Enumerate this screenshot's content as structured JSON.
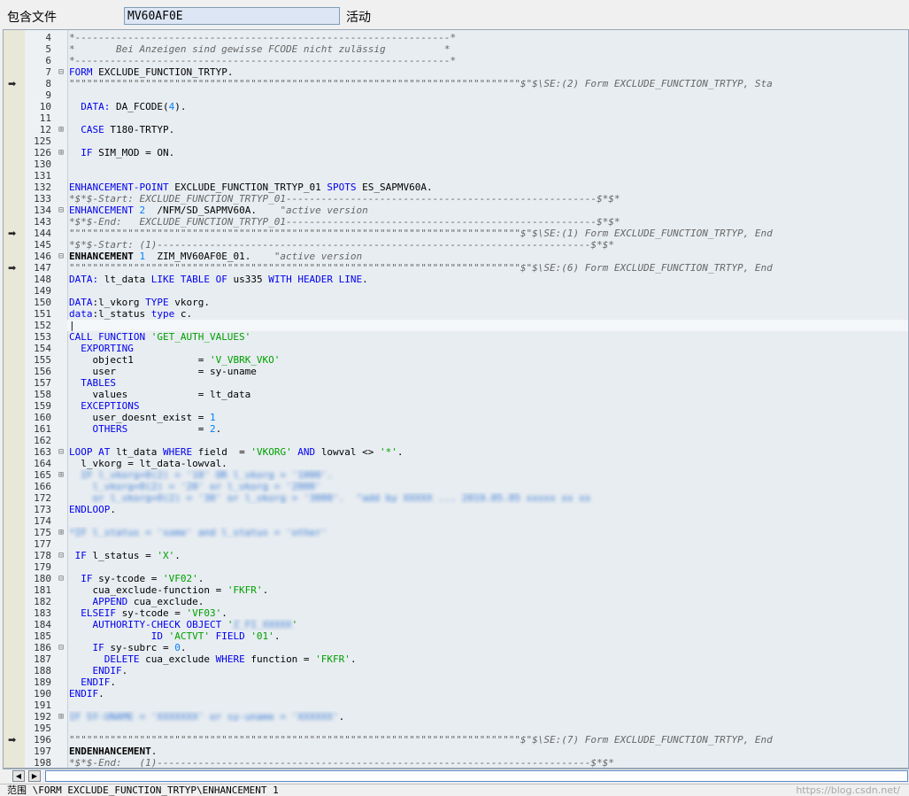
{
  "header": {
    "include_label": "包含文件",
    "program_name": "MV60AF0E",
    "status": "活动"
  },
  "editor": {
    "lines": [
      {
        "n": "4",
        "fold": "",
        "arrow": false,
        "segs": [
          [
            "cmt",
            "*----------------------------------------------------------------*"
          ]
        ]
      },
      {
        "n": "5",
        "fold": "",
        "arrow": false,
        "segs": [
          [
            "cmt",
            "*       Bei Anzeigen sind gewisse FCODE nicht zulässig          *"
          ]
        ]
      },
      {
        "n": "6",
        "fold": "",
        "arrow": false,
        "segs": [
          [
            "cmt",
            "*----------------------------------------------------------------*"
          ]
        ]
      },
      {
        "n": "7",
        "fold": "⊟",
        "arrow": false,
        "segs": [
          [
            "kw",
            "FORM "
          ],
          [
            "plain",
            "EXCLUDE_FUNCTION_TRTYP."
          ]
        ]
      },
      {
        "n": "8",
        "fold": "",
        "arrow": true,
        "segs": [
          [
            "cmt",
            "\"\"\"\"\"\"\"\"\"\"\"\"\"\"\"\"\"\"\"\"\"\"\"\"\"\"\"\"\"\"\"\"\"\"\"\"\"\"\"\"\"\"\"\"\"\"\"\"\"\"\"\"\"\"\"\"\"\"\"\"\"\"\"\"\"\"\"\"\"\"\"\"\"\"\"\"\"$\"$\\SE:(2) Form EXCLUDE_FUNCTION_TRTYP, Sta"
          ]
        ]
      },
      {
        "n": "9",
        "fold": "",
        "arrow": false,
        "segs": []
      },
      {
        "n": "10",
        "fold": "",
        "arrow": false,
        "segs": [
          [
            "kw",
            "  DATA: "
          ],
          [
            "plain",
            "DA_FCODE("
          ],
          [
            "num",
            "4"
          ],
          [
            "plain",
            ")."
          ]
        ]
      },
      {
        "n": "11",
        "fold": "",
        "arrow": false,
        "segs": []
      },
      {
        "n": "12",
        "fold": "⊞",
        "arrow": false,
        "segs": [
          [
            "kw",
            "  CASE "
          ],
          [
            "plain",
            "T180-TRTYP."
          ]
        ]
      },
      {
        "n": "125",
        "fold": "",
        "arrow": false,
        "segs": []
      },
      {
        "n": "126",
        "fold": "⊞",
        "arrow": false,
        "segs": [
          [
            "kw",
            "  IF "
          ],
          [
            "plain",
            "SIM_MOD = ON."
          ]
        ]
      },
      {
        "n": "130",
        "fold": "",
        "arrow": false,
        "segs": []
      },
      {
        "n": "131",
        "fold": "",
        "arrow": false,
        "segs": []
      },
      {
        "n": "132",
        "fold": "",
        "arrow": false,
        "segs": [
          [
            "kw",
            "ENHANCEMENT-POINT "
          ],
          [
            "plain",
            "EXCLUDE_FUNCTION_TRTYP_01 "
          ],
          [
            "kw",
            "SPOTS "
          ],
          [
            "plain",
            "ES_SAPMV60A."
          ]
        ]
      },
      {
        "n": "133",
        "fold": "",
        "arrow": false,
        "segs": [
          [
            "cmt",
            "*$*$-Start: EXCLUDE_FUNCTION_TRTYP_01-----------------------------------------------------$*$*"
          ]
        ]
      },
      {
        "n": "134",
        "fold": "⊟",
        "arrow": false,
        "segs": [
          [
            "kw",
            "ENHANCEMENT "
          ],
          [
            "num",
            "2"
          ],
          [
            "plain",
            "  /NFM/SD_SAPMV60A.    "
          ],
          [
            "cmt",
            "\"active version"
          ]
        ]
      },
      {
        "n": "143",
        "fold": "",
        "arrow": false,
        "segs": [
          [
            "cmt",
            "*$*$-End:   EXCLUDE_FUNCTION_TRTYP_01-----------------------------------------------------$*$*"
          ]
        ]
      },
      {
        "n": "144",
        "fold": "",
        "arrow": true,
        "segs": [
          [
            "cmt",
            "\"\"\"\"\"\"\"\"\"\"\"\"\"\"\"\"\"\"\"\"\"\"\"\"\"\"\"\"\"\"\"\"\"\"\"\"\"\"\"\"\"\"\"\"\"\"\"\"\"\"\"\"\"\"\"\"\"\"\"\"\"\"\"\"\"\"\"\"\"\"\"\"\"\"\"\"\"$\"$\\SE:(1) Form EXCLUDE_FUNCTION_TRTYP, End"
          ]
        ]
      },
      {
        "n": "145",
        "fold": "",
        "arrow": false,
        "segs": [
          [
            "cmt",
            "*$*$-Start: (1)--------------------------------------------------------------------------$*$*"
          ]
        ]
      },
      {
        "n": "146",
        "fold": "⊟",
        "arrow": false,
        "segs": [
          [
            "bold",
            "ENHANCEMENT "
          ],
          [
            "num",
            "1"
          ],
          [
            "plain",
            "  ZIM_MV60AF0E_01.    "
          ],
          [
            "cmt",
            "\"active version"
          ]
        ]
      },
      {
        "n": "147",
        "fold": "",
        "arrow": true,
        "segs": [
          [
            "cmt",
            "\"\"\"\"\"\"\"\"\"\"\"\"\"\"\"\"\"\"\"\"\"\"\"\"\"\"\"\"\"\"\"\"\"\"\"\"\"\"\"\"\"\"\"\"\"\"\"\"\"\"\"\"\"\"\"\"\"\"\"\"\"\"\"\"\"\"\"\"\"\"\"\"\"\"\"\"\"$\"$\\SE:(6) Form EXCLUDE_FUNCTION_TRTYP, End"
          ]
        ]
      },
      {
        "n": "148",
        "fold": "",
        "arrow": false,
        "segs": [
          [
            "kw",
            "DATA: "
          ],
          [
            "plain",
            "lt_data "
          ],
          [
            "kw",
            "LIKE TABLE OF "
          ],
          [
            "plain",
            "us335 "
          ],
          [
            "kw",
            "WITH HEADER LINE"
          ],
          [
            "plain",
            "."
          ]
        ]
      },
      {
        "n": "149",
        "fold": "",
        "arrow": false,
        "segs": []
      },
      {
        "n": "150",
        "fold": "",
        "arrow": false,
        "segs": [
          [
            "kw",
            "DATA"
          ],
          [
            "plain",
            ":l_vkorg "
          ],
          [
            "kw",
            "TYPE "
          ],
          [
            "plain",
            "vkorg."
          ]
        ]
      },
      {
        "n": "151",
        "fold": "",
        "arrow": false,
        "segs": [
          [
            "kw",
            "data"
          ],
          [
            "plain",
            ":l_status "
          ],
          [
            "kw",
            "type "
          ],
          [
            "plain",
            "c."
          ]
        ]
      },
      {
        "n": "152",
        "fold": "",
        "arrow": false,
        "segs": [
          [
            "plain",
            "|"
          ]
        ]
      },
      {
        "n": "153",
        "fold": "",
        "arrow": false,
        "segs": [
          [
            "kw",
            "CALL FUNCTION "
          ],
          [
            "str",
            "'GET_AUTH_VALUES'"
          ]
        ]
      },
      {
        "n": "154",
        "fold": "",
        "arrow": false,
        "segs": [
          [
            "kw",
            "  EXPORTING"
          ]
        ]
      },
      {
        "n": "155",
        "fold": "",
        "arrow": false,
        "segs": [
          [
            "plain",
            "    object1           = "
          ],
          [
            "str",
            "'V_VBRK_VKO'"
          ]
        ]
      },
      {
        "n": "156",
        "fold": "",
        "arrow": false,
        "segs": [
          [
            "plain",
            "    user              = sy-uname"
          ]
        ]
      },
      {
        "n": "157",
        "fold": "",
        "arrow": false,
        "segs": [
          [
            "kw",
            "  TABLES"
          ]
        ]
      },
      {
        "n": "158",
        "fold": "",
        "arrow": false,
        "segs": [
          [
            "plain",
            "    values            = lt_data"
          ]
        ]
      },
      {
        "n": "159",
        "fold": "",
        "arrow": false,
        "segs": [
          [
            "kw",
            "  EXCEPTIONS"
          ]
        ]
      },
      {
        "n": "160",
        "fold": "",
        "arrow": false,
        "segs": [
          [
            "plain",
            "    user_doesnt_exist = "
          ],
          [
            "num",
            "1"
          ]
        ]
      },
      {
        "n": "161",
        "fold": "",
        "arrow": false,
        "segs": [
          [
            "kw",
            "    OTHERS            "
          ],
          [
            "plain",
            "= "
          ],
          [
            "num",
            "2"
          ],
          [
            "plain",
            "."
          ]
        ]
      },
      {
        "n": "162",
        "fold": "",
        "arrow": false,
        "segs": []
      },
      {
        "n": "163",
        "fold": "⊟",
        "arrow": false,
        "segs": [
          [
            "kw",
            "LOOP AT "
          ],
          [
            "plain",
            "lt_data "
          ],
          [
            "kw",
            "WHERE "
          ],
          [
            "plain",
            "field  = "
          ],
          [
            "str",
            "'VKORG'"
          ],
          [
            "kw",
            " AND "
          ],
          [
            "plain",
            "lowval <> "
          ],
          [
            "str",
            "'*'"
          ],
          [
            "plain",
            "."
          ]
        ]
      },
      {
        "n": "164",
        "fold": "",
        "arrow": false,
        "segs": [
          [
            "plain",
            "  l_vkorg = lt_data-lowval."
          ]
        ]
      },
      {
        "n": "165",
        "fold": "⊞",
        "arrow": false,
        "segs": [
          [
            "blur",
            "  IF l_vkorg+0(2) = '10' OR l_vkorg = '1000'."
          ]
        ]
      },
      {
        "n": "166",
        "fold": "",
        "arrow": false,
        "segs": [
          [
            "blur",
            "    l_vkorg+0(2) = '20' or l_vkorg = '2000'"
          ]
        ]
      },
      {
        "n": "172",
        "fold": "",
        "arrow": false,
        "segs": [
          [
            "blur",
            "    or l_vkorg+0(2) = '30' or l_vkorg = '3000'.  \"add by XXXXX ... 2019.05.05 xxxxx xx xx"
          ]
        ]
      },
      {
        "n": "173",
        "fold": "",
        "arrow": false,
        "segs": [
          [
            "kw",
            "ENDLOOP"
          ],
          [
            "plain",
            "."
          ]
        ]
      },
      {
        "n": "174",
        "fold": "",
        "arrow": false,
        "segs": []
      },
      {
        "n": "175",
        "fold": "⊞",
        "arrow": false,
        "segs": [
          [
            "blur",
            "*IF l_status = 'some' and l_status = 'other'"
          ]
        ]
      },
      {
        "n": "177",
        "fold": "",
        "arrow": false,
        "segs": []
      },
      {
        "n": "178",
        "fold": "⊟",
        "arrow": false,
        "segs": [
          [
            "kw",
            " IF "
          ],
          [
            "plain",
            "l_status = "
          ],
          [
            "str",
            "'X'"
          ],
          [
            "plain",
            "."
          ]
        ]
      },
      {
        "n": "179",
        "fold": "",
        "arrow": false,
        "segs": []
      },
      {
        "n": "180",
        "fold": "⊟",
        "arrow": false,
        "segs": [
          [
            "kw",
            "  IF "
          ],
          [
            "plain",
            "sy-tcode = "
          ],
          [
            "str",
            "'VF02'"
          ],
          [
            "plain",
            "."
          ]
        ]
      },
      {
        "n": "181",
        "fold": "",
        "arrow": false,
        "segs": [
          [
            "plain",
            "    cua_exclude-function = "
          ],
          [
            "str",
            "'FKFR'"
          ],
          [
            "plain",
            "."
          ]
        ]
      },
      {
        "n": "182",
        "fold": "",
        "arrow": false,
        "segs": [
          [
            "kw",
            "    APPEND "
          ],
          [
            "plain",
            "cua_exclude."
          ]
        ]
      },
      {
        "n": "183",
        "fold": "",
        "arrow": false,
        "segs": [
          [
            "kw",
            "  ELSEIF "
          ],
          [
            "plain",
            "sy-tcode = "
          ],
          [
            "str",
            "'VF03'"
          ],
          [
            "plain",
            "."
          ]
        ]
      },
      {
        "n": "184",
        "fold": "",
        "arrow": false,
        "segs": [
          [
            "kw",
            "    AUTHORITY-CHECK OBJECT "
          ],
          [
            "str",
            "'"
          ],
          [
            "blur",
            "Z_FI_XXXXX"
          ],
          [
            "str",
            "'"
          ]
        ]
      },
      {
        "n": "185",
        "fold": "",
        "arrow": false,
        "segs": [
          [
            "kw",
            "              ID "
          ],
          [
            "str",
            "'ACTVT'"
          ],
          [
            "kw",
            " FIELD "
          ],
          [
            "str",
            "'01'"
          ],
          [
            "plain",
            "."
          ]
        ]
      },
      {
        "n": "186",
        "fold": "⊟",
        "arrow": false,
        "segs": [
          [
            "kw",
            "    IF "
          ],
          [
            "plain",
            "sy-subrc = "
          ],
          [
            "num",
            "0"
          ],
          [
            "plain",
            "."
          ]
        ]
      },
      {
        "n": "187",
        "fold": "",
        "arrow": false,
        "segs": [
          [
            "kw",
            "      DELETE "
          ],
          [
            "plain",
            "cua_exclude "
          ],
          [
            "kw",
            "WHERE "
          ],
          [
            "plain",
            "function = "
          ],
          [
            "str",
            "'FKFR'"
          ],
          [
            "plain",
            "."
          ]
        ]
      },
      {
        "n": "188",
        "fold": "",
        "arrow": false,
        "segs": [
          [
            "kw",
            "    ENDIF"
          ],
          [
            "plain",
            "."
          ]
        ]
      },
      {
        "n": "189",
        "fold": "",
        "arrow": false,
        "segs": [
          [
            "kw",
            "  ENDIF"
          ],
          [
            "plain",
            "."
          ]
        ]
      },
      {
        "n": "190",
        "fold": "",
        "arrow": false,
        "segs": [
          [
            "kw",
            "ENDIF"
          ],
          [
            "plain",
            "."
          ]
        ]
      },
      {
        "n": "191",
        "fold": "",
        "arrow": false,
        "segs": []
      },
      {
        "n": "192",
        "fold": "⊞",
        "arrow": false,
        "segs": [
          [
            "blur",
            "IF SY-UNAME = 'XXXXXXX' or sy-uname = 'XXXXXX'"
          ],
          [
            "plain",
            "."
          ]
        ]
      },
      {
        "n": "195",
        "fold": "",
        "arrow": false,
        "segs": []
      },
      {
        "n": "196",
        "fold": "",
        "arrow": true,
        "segs": [
          [
            "cmt",
            "\"\"\"\"\"\"\"\"\"\"\"\"\"\"\"\"\"\"\"\"\"\"\"\"\"\"\"\"\"\"\"\"\"\"\"\"\"\"\"\"\"\"\"\"\"\"\"\"\"\"\"\"\"\"\"\"\"\"\"\"\"\"\"\"\"\"\"\"\"\"\"\"\"\"\"\"\"$\"$\\SE:(7) Form EXCLUDE_FUNCTION_TRTYP, End"
          ]
        ]
      },
      {
        "n": "197",
        "fold": "",
        "arrow": false,
        "segs": [
          [
            "bold",
            "ENDENHANCEMENT"
          ],
          [
            "plain",
            "."
          ]
        ]
      },
      {
        "n": "198",
        "fold": "",
        "arrow": false,
        "segs": [
          [
            "cmt",
            "*$*$-End:   (1)--------------------------------------------------------------------------$*$*"
          ]
        ]
      }
    ]
  },
  "statusbar": {
    "scope": "范围 \\FORM EXCLUDE_FUNCTION_TRTYP\\ENHANCEMENT 1",
    "watermark": "https://blog.csdn.net/"
  }
}
